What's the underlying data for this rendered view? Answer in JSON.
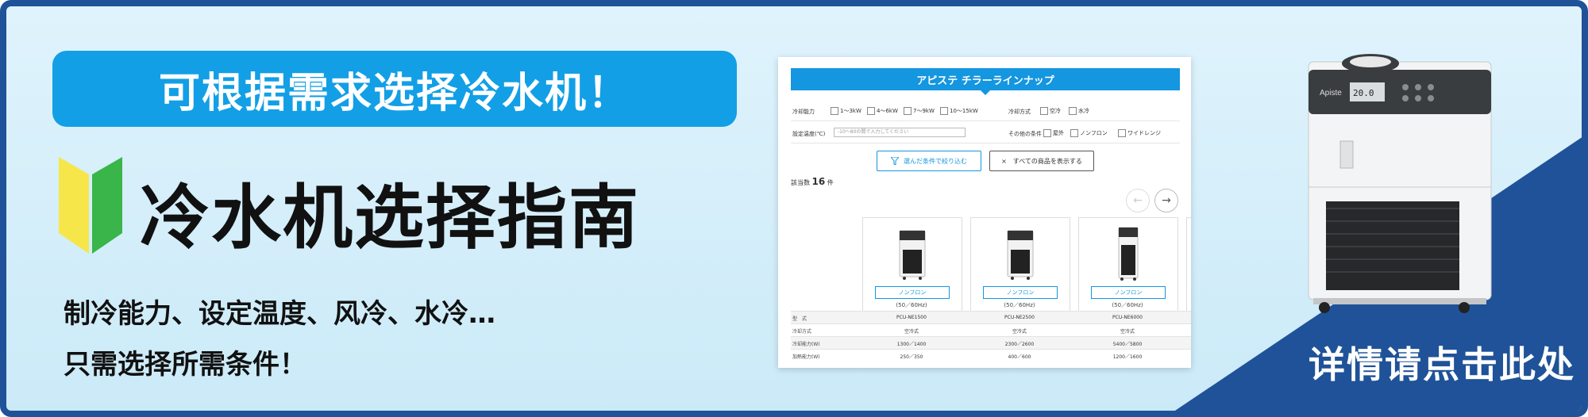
{
  "banner": {
    "headline": "可根据需求选择冷水机！",
    "title": "冷水机选择指南",
    "desc_line1": "制冷能力、设定温度、风冷、水冷…",
    "desc_line2": "只需选择所需条件！",
    "cta": "详情请点击此处",
    "colors": {
      "border": "#1f5298",
      "triangle": "#1f5298",
      "pill": "#129fe6",
      "bg": "#d6eefa"
    }
  },
  "product_image": {
    "brand": "Apiste",
    "display": "20.0"
  },
  "screenshot": {
    "header": "アピステ チラーラインナップ",
    "filters": {
      "cooling_capacity_label": "冷却能力",
      "capacity_options": [
        "1～3kW",
        "4～6kW",
        "7～9kW",
        "10～15kW"
      ],
      "cooling_method_label": "冷却方式",
      "method_options": [
        "空冷",
        "水冷"
      ],
      "set_temp_label": "設定温度(℃)",
      "set_temp_placeholder": "-10～80の間で入力してください",
      "other_label": "その他の条件",
      "other_options": [
        "屋外",
        "ノンフロン",
        "ワイドレンジ"
      ]
    },
    "filter_button": "選んだ条件で絞り込む",
    "show_all_button": "すべての商品を表示する",
    "show_all_icon": "×",
    "result_prefix": "該当数",
    "result_count": "16",
    "result_suffix": "件",
    "products": [
      {
        "tag": "ノンフロン",
        "hz": "(50／60Hz)",
        "model": "PCU-NE1500",
        "method": "空冷式",
        "capacity": "1300／1400",
        "heating": "250／350"
      },
      {
        "tag": "ノンフロン",
        "hz": "(50／60Hz)",
        "model": "PCU-NE2500",
        "method": "空冷式",
        "capacity": "2300／2600",
        "heating": "400／600"
      },
      {
        "tag": "ノンフロン",
        "hz": "(50／60Hz)",
        "model": "PCU-NE6000",
        "method": "空冷式",
        "capacity": "5400／5800",
        "heating": "1200／1600"
      }
    ],
    "row_labels": [
      "型　式",
      "冷却方式",
      "冷却能力(W)",
      "加熱能力(W)"
    ]
  }
}
